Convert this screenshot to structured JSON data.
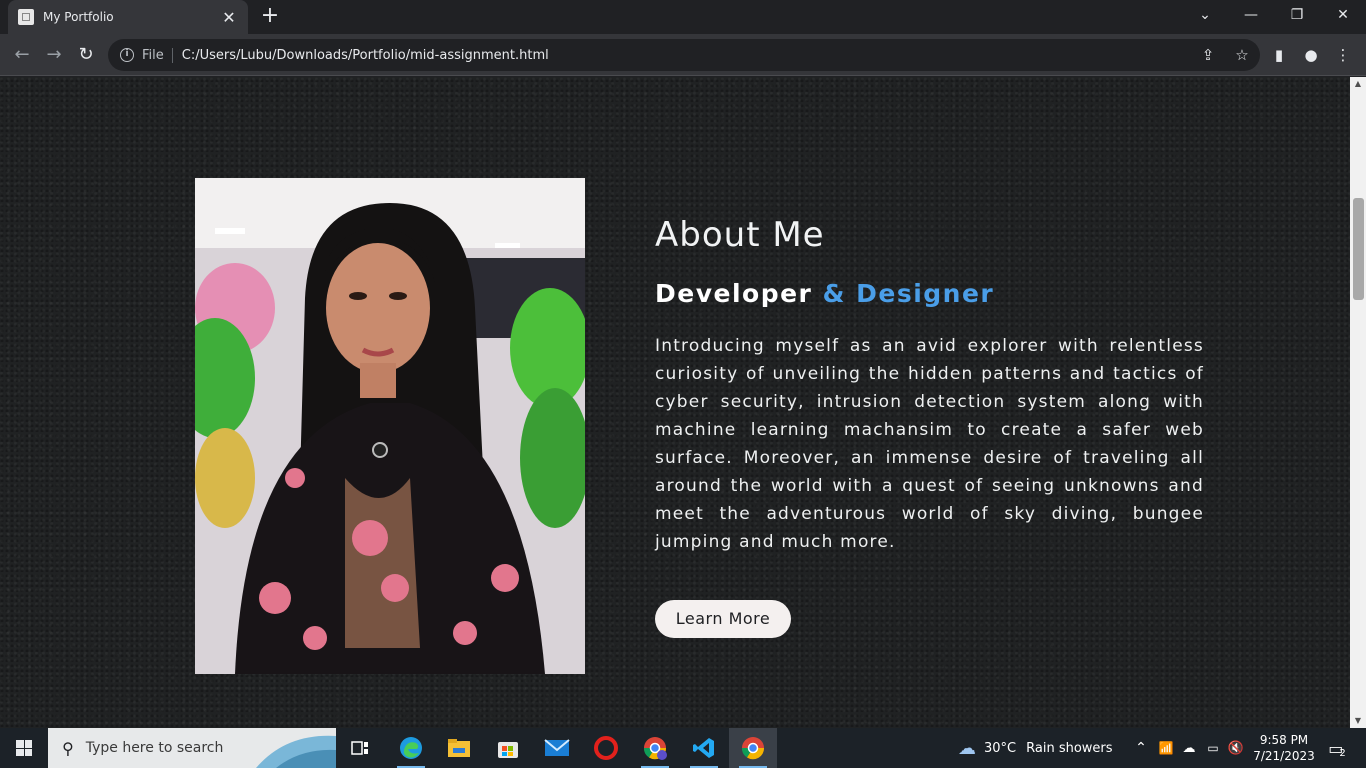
{
  "browser": {
    "tab_title": "My Portfolio",
    "new_tab": "+",
    "scheme_label": "File",
    "url": "C:/Users/Lubu/Downloads/Portfolio/mid-assignment.html"
  },
  "about": {
    "heading": "About Me",
    "subtitle_primary": "Developer",
    "subtitle_accent": "& Designer",
    "paragraph": "Introducing myself as an avid explorer with relentless curiosity of unveiling the hidden patterns and tactics of cyber security, intrusion detection system along with machine learning machansim to create a safer web surface. Moreover, an immense desire of traveling all around the world with a quest of seeing unknowns and meet the adventurous world of sky diving, bungee jumping and much more.",
    "button": "Learn More"
  },
  "taskbar": {
    "search_placeholder": "Type here to search",
    "weather_temp": "30°C",
    "weather_desc": "Rain showers",
    "time": "9:58 PM",
    "date": "7/21/2023",
    "notification_count": "2"
  },
  "colors": {
    "accent": "#4a9ee8",
    "page_bg": "#202223",
    "button_bg": "#f4f0ef"
  }
}
